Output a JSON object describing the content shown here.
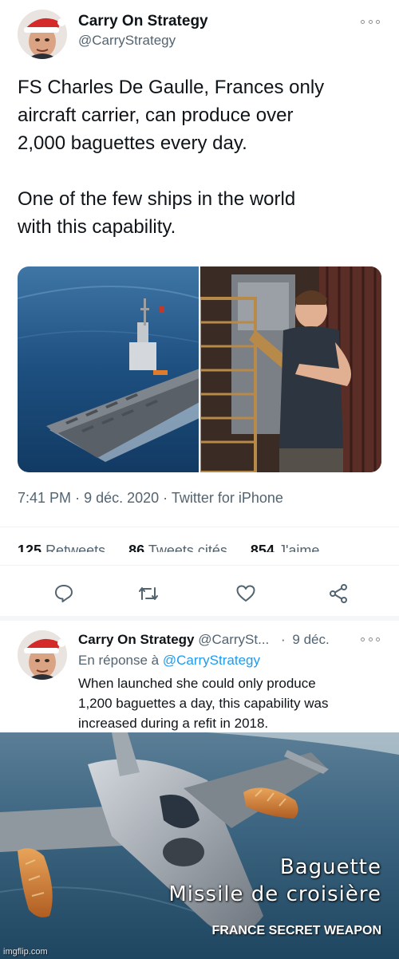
{
  "tweet": {
    "author_name": "Carry On Strategy",
    "author_handle": "@CarryStrategy",
    "text_p1": "FS Charles De Gaulle, Frances only\naircraft carrier, can produce over\n2,000 baguettes every day.",
    "text_p2": "One of the few ships in the world\nwith this capability.",
    "time": "7:41 PM",
    "date": "9 déc. 2020",
    "source": "Twitter for iPhone",
    "stats": {
      "retweets_count": "125",
      "retweets_label": "Retweets",
      "quotes_count": "86",
      "quotes_label": "Tweets cités",
      "likes_count": "854",
      "likes_label": "J'aime"
    },
    "media_icons": [
      "aircraft-carrier-photo",
      "baker-bread-oven-photo"
    ]
  },
  "actions": {
    "icons": [
      "reply-icon",
      "retweet-icon",
      "like-icon",
      "share-icon"
    ]
  },
  "reply": {
    "author_name": "Carry On Strategy",
    "author_handle": "@CarrySt...",
    "dot": "·",
    "date": "9 déc.",
    "reply_prefix": "En réponse à",
    "reply_to": "@CarryStrategy",
    "text": "When launched she could only produce\n1,200 baguettes a day, this capability was\nincreased during a refit in 2018."
  },
  "meme": {
    "caption_line1": "Baguette",
    "caption_line2": "Missile de croisière",
    "caption_line3": "FRANCE SECRET WEAPON",
    "watermark": "imgflip.com"
  },
  "colors": {
    "text": "#0f1419",
    "secondary": "#536471",
    "link": "#1d9bf0",
    "separator": "#eff3f4"
  }
}
